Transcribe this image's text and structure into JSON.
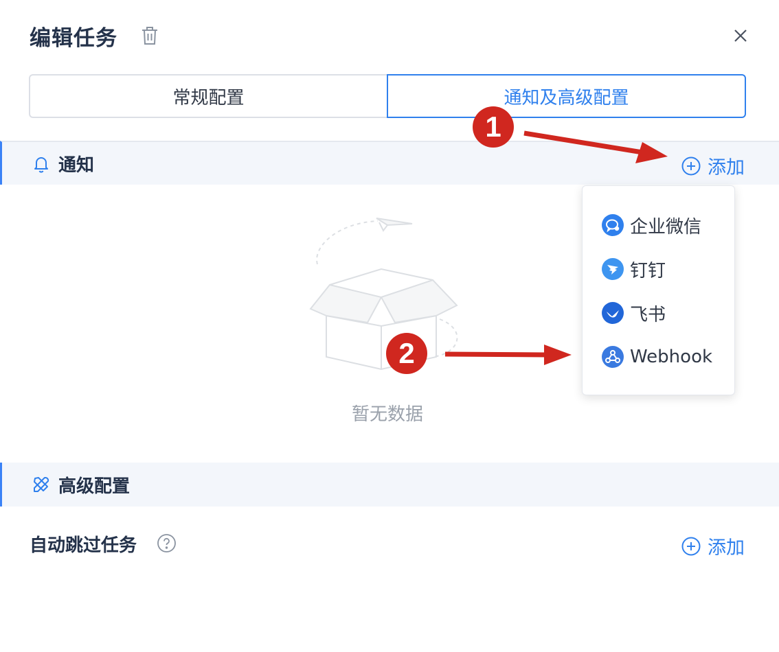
{
  "dialog": {
    "title": "编辑任务"
  },
  "tabs": [
    {
      "label": "常规配置",
      "active": false
    },
    {
      "label": "通知及高级配置",
      "active": true
    }
  ],
  "notification": {
    "title": "通知",
    "add_label": "添加",
    "empty_text": "暂无数据",
    "menu": [
      {
        "label": "企业微信",
        "icon": "wechat-work-icon"
      },
      {
        "label": "钉钉",
        "icon": "dingtalk-icon"
      },
      {
        "label": "飞书",
        "icon": "feishu-icon"
      },
      {
        "label": "Webhook",
        "icon": "webhook-icon"
      }
    ]
  },
  "advanced": {
    "title": "高级配置",
    "skip_label": "自动跳过任务",
    "add_label": "添加"
  },
  "annotations": [
    {
      "number": "1"
    },
    {
      "number": "2"
    }
  ],
  "colors": {
    "accent": "#2f80ed",
    "annotation": "#d0271f",
    "section_bg": "#f3f6fb"
  }
}
